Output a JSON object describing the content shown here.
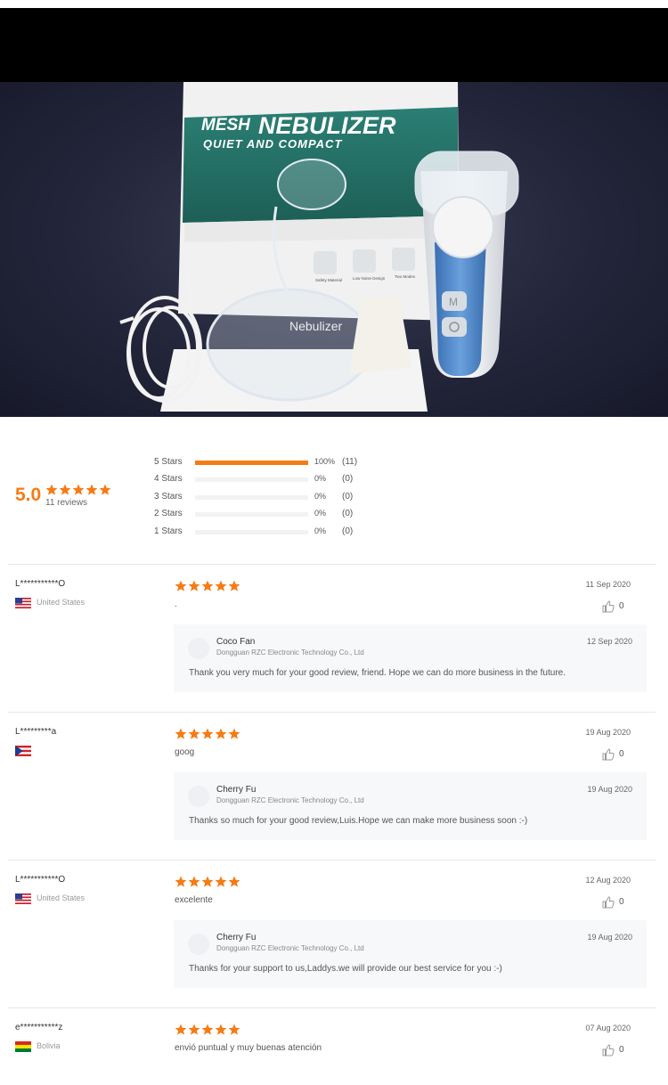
{
  "product_image": {
    "box_title_top": "MESH",
    "box_title_main": "NEBULIZER",
    "box_subtitle": "QUIET AND COMPACT",
    "box_features": [
      "Safety Material",
      "Low Noise Design",
      "Two Modes"
    ],
    "mask_text": "Nebulizer",
    "device_button_mode": "M"
  },
  "summary": {
    "score": "5.0",
    "reviews_count": "11 reviews",
    "distribution": [
      {
        "label": "5  Stars",
        "percent_text": "100%",
        "count": "(11)",
        "fraction": 1.0
      },
      {
        "label": "4  Stars",
        "percent_text": "0%",
        "count": "(0)",
        "fraction": 0
      },
      {
        "label": "3  Stars",
        "percent_text": "0%",
        "count": "(0)",
        "fraction": 0
      },
      {
        "label": "2  Stars",
        "percent_text": "0%",
        "count": "(0)",
        "fraction": 0
      },
      {
        "label": "1  Stars",
        "percent_text": "0%",
        "count": "(0)",
        "fraction": 0
      }
    ]
  },
  "reviews": [
    {
      "user": "L***********O",
      "country": "United States",
      "flag": "us",
      "rating": 5,
      "date": "11 Sep 2020",
      "text": ".",
      "likes": "0",
      "reply": {
        "name": "Coco Fan",
        "company": "Dongguan RZC Electronic Technology Co., Ltd",
        "date": "12 Sep 2020",
        "text": "Thank you very much for your good review, friend. Hope we can do more business in the future."
      }
    },
    {
      "user": "L*********a",
      "country": "",
      "flag": "pr",
      "rating": 5,
      "date": "19 Aug 2020",
      "text": "goog",
      "likes": "0",
      "reply": {
        "name": "Cherry Fu",
        "company": "Dongguan RZC Electronic Technology Co., Ltd",
        "date": "19 Aug 2020",
        "text": "Thanks so much for your good review,Luis.Hope we can make more business soon :-)"
      }
    },
    {
      "user": "L***********O",
      "country": "United States",
      "flag": "us",
      "rating": 5,
      "date": "12 Aug 2020",
      "text": "excelente",
      "likes": "0",
      "reply": {
        "name": "Cherry Fu",
        "company": "Dongguan RZC Electronic Technology Co., Ltd",
        "date": "19 Aug 2020",
        "text": "Thanks for your support to us,Laddys.we will provide our best service for you :-)"
      }
    },
    {
      "user": "e***********z",
      "country": "Bolivia",
      "flag": "bo",
      "rating": 5,
      "date": "07 Aug 2020",
      "text": "envió puntual y muy buenas atención",
      "likes": "0"
    }
  ],
  "colors": {
    "accent": "#f47c16",
    "box_teal": "#2f7e72",
    "device_blue": "#4c86c8"
  }
}
